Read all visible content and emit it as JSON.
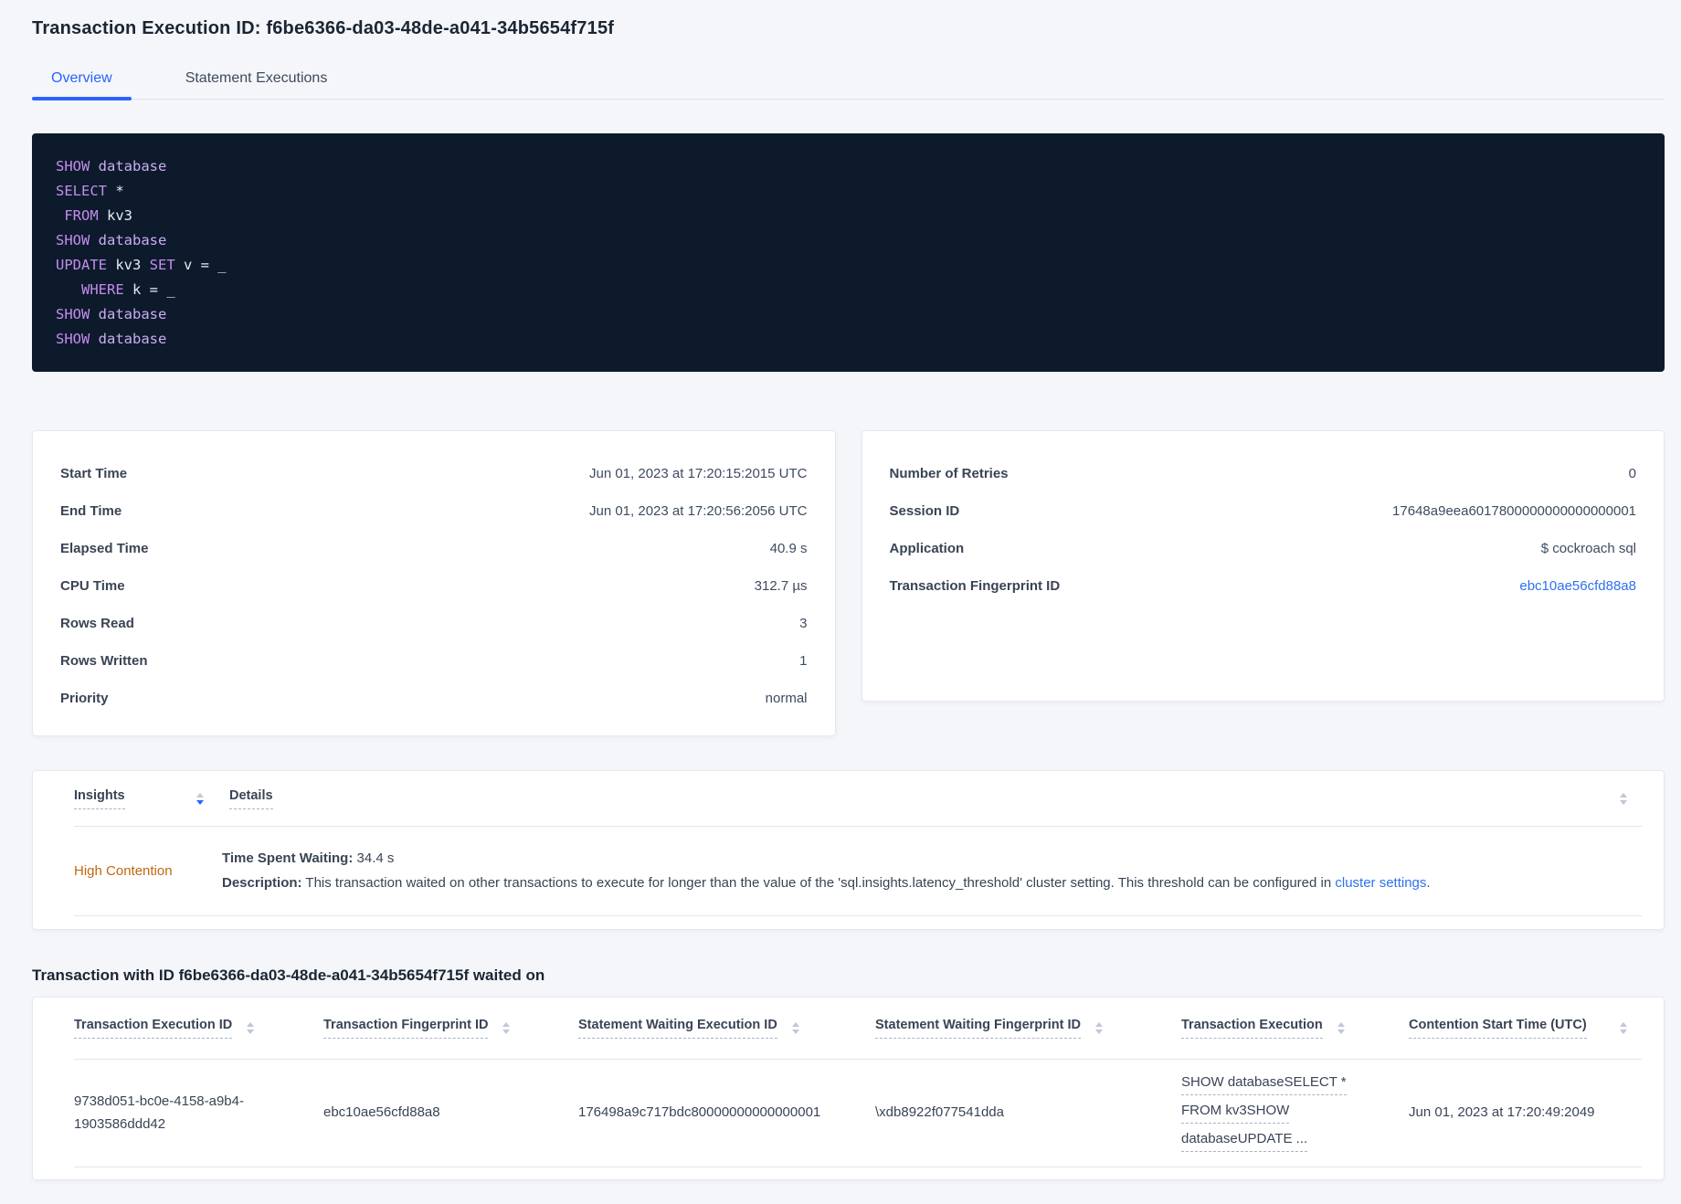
{
  "header": {
    "title": "Transaction Execution ID: f6be6366-da03-48de-a041-34b5654f715f",
    "tabs": [
      {
        "label": "Overview",
        "active": true
      },
      {
        "label": "Statement Executions",
        "active": false
      }
    ]
  },
  "sql": {
    "lines": [
      [
        {
          "t": "SHOW ",
          "c": "kw"
        },
        {
          "t": "database",
          "c": "db"
        }
      ],
      [
        {
          "t": "SELECT ",
          "c": "kw"
        },
        {
          "t": "*",
          "c": "id"
        }
      ],
      [
        {
          "t": " ",
          "c": "id"
        },
        {
          "t": "FROM ",
          "c": "kw"
        },
        {
          "t": "kv3",
          "c": "id"
        }
      ],
      [
        {
          "t": "SHOW ",
          "c": "kw"
        },
        {
          "t": "database",
          "c": "db"
        }
      ],
      [
        {
          "t": "UPDATE ",
          "c": "kw"
        },
        {
          "t": "kv3 ",
          "c": "id"
        },
        {
          "t": "SET ",
          "c": "kw"
        },
        {
          "t": "v = _",
          "c": "id"
        }
      ],
      [
        {
          "t": "   ",
          "c": "id"
        },
        {
          "t": "WHERE ",
          "c": "kw"
        },
        {
          "t": "k = _",
          "c": "id"
        }
      ],
      [
        {
          "t": "SHOW ",
          "c": "kw"
        },
        {
          "t": "database",
          "c": "db"
        }
      ],
      [
        {
          "t": "SHOW ",
          "c": "kw"
        },
        {
          "t": "database",
          "c": "db"
        }
      ]
    ]
  },
  "summary_left": {
    "rows": [
      {
        "label": "Start Time",
        "value": "Jun 01, 2023 at 17:20:15:2015 UTC"
      },
      {
        "label": "End Time",
        "value": "Jun 01, 2023 at 17:20:56:2056 UTC"
      },
      {
        "label": "Elapsed Time",
        "value": "40.9 s"
      },
      {
        "label": "CPU Time",
        "value": "312.7 µs"
      },
      {
        "label": "Rows Read",
        "value": "3"
      },
      {
        "label": "Rows Written",
        "value": "1"
      },
      {
        "label": "Priority",
        "value": "normal"
      }
    ]
  },
  "summary_right": {
    "rows": [
      {
        "label": "Number of Retries",
        "value": "0"
      },
      {
        "label": "Session ID",
        "value": "17648a9eea6017800000000000000001"
      },
      {
        "label": "Application",
        "value": "$ cockroach sql"
      }
    ],
    "fingerprint_label": "Transaction Fingerprint ID",
    "fingerprint_value": "ebc10ae56cfd88a8"
  },
  "insights_table": {
    "columns": [
      {
        "label": "Insights"
      },
      {
        "label": "Details"
      }
    ],
    "row": {
      "insight": "High Contention",
      "waiting_label": "Time Spent Waiting:",
      "waiting_value": " 34.4 s",
      "description_label": "Description:",
      "description_text": " This transaction waited on other transactions to execute for longer than the value of the 'sql.insights.latency_threshold' cluster setting. This threshold can be configured in ",
      "description_link": "cluster settings",
      "description_suffix": "."
    }
  },
  "waited_section": {
    "heading": "Transaction with ID f6be6366-da03-48de-a041-34b5654f715f waited on",
    "columns": [
      {
        "label": "Transaction Execution ID"
      },
      {
        "label": "Transaction Fingerprint ID"
      },
      {
        "label": "Statement Waiting Execution ID"
      },
      {
        "label": "Statement Waiting Fingerprint ID"
      },
      {
        "label": "Transaction Execution"
      },
      {
        "label": "Contention Start Time (UTC)"
      }
    ],
    "row": {
      "transaction_execution_id": "9738d051-bc0e-4158-a9b4-1903586ddd42",
      "transaction_fingerprint_id": "ebc10ae56cfd88a8",
      "statement_waiting_execution_id": "176498a9c717bdc80000000000000001",
      "statement_waiting_fingerprint_id": "\\xdb8922f077541dda",
      "transaction_execution_lines": [
        "SHOW databaseSELECT *",
        "FROM kv3SHOW",
        "databaseUPDATE ..."
      ],
      "contention_start_time": "Jun 01, 2023 at 17:20:49:2049"
    }
  },
  "colors": {
    "accent_blue": "#2962ff",
    "link_blue": "#2d72ee",
    "insight_orange": "#c2660f",
    "code_background": "#0d1a2c",
    "code_keyword": "#c48ced",
    "code_identifier": "#e8e9f4",
    "page_background": "#f4f6fa"
  }
}
